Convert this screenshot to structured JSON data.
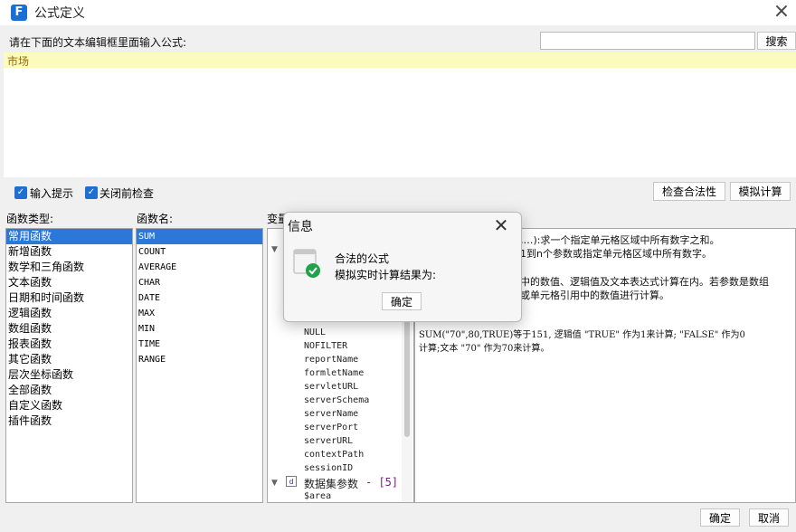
{
  "window": {
    "title": "公式定义",
    "app_icon_letter": "F"
  },
  "editor": {
    "prompt": "请在下面的文本编辑框里面输入公式:",
    "search_button": "搜索",
    "formula_text": "市场"
  },
  "options": {
    "input_hint": {
      "label": "输入提示",
      "checked": true
    },
    "check_before_close": {
      "label": "关闭前检查",
      "checked": true
    },
    "validate_button": "检查合法性",
    "simulate_button": "模拟计算"
  },
  "function_types": {
    "header": "函数类型:",
    "items": [
      "常用函数",
      "新增函数",
      "数学和三角函数",
      "文本函数",
      "日期和时间函数",
      "逻辑函数",
      "数组函数",
      "报表函数",
      "其它函数",
      "层次坐标函数",
      "全部函数",
      "自定义函数",
      "插件函数"
    ],
    "selected_index": 0
  },
  "function_names": {
    "header": "函数名:",
    "items": [
      "SUM",
      "COUNT",
      "AVERAGE",
      "CHAR",
      "DATE",
      "MAX",
      "MIN",
      "TIME",
      "RANGE"
    ],
    "selected_index": 0
  },
  "variables": {
    "header": "变量",
    "items": [
      "NULL",
      "NOFILTER",
      "reportName",
      "formletName",
      "servletURL",
      "serverSchema",
      "serverName",
      "serverPort",
      "serverURL",
      "contextPath",
      "sessionID"
    ],
    "group_label": "数据集参数",
    "group_count": "- [5]",
    "group_items": [
      "$area"
    ]
  },
  "description": {
    "lines": [
      ",…):求一个指定单元格区域中所有数字之和。",
      "1到n个参数或指定单元格区域中所有数字。",
      "中的数值、逻辑值及文本表达式计算在内。若参数是数组",
      "或单元格引用中的数值进行计算。",
      "SUM(\"70\",80,TRUE)等于151, 逻辑值 \"TRUE\" 作为1来计算; \"FALSE\" 作为0",
      "计算;文本 \"70\" 作为70来计算。"
    ]
  },
  "footer": {
    "ok_button": "确定",
    "cancel_button": "取消"
  },
  "dialog": {
    "title": "信息",
    "message_line1": "合法的公式",
    "message_line2": "模拟实时计算结果为:",
    "ok_button": "确定"
  },
  "colors": {
    "accent": "#2b78d8",
    "editor_highlight": "#fbfbbe",
    "check_green": "#1fa34a"
  }
}
